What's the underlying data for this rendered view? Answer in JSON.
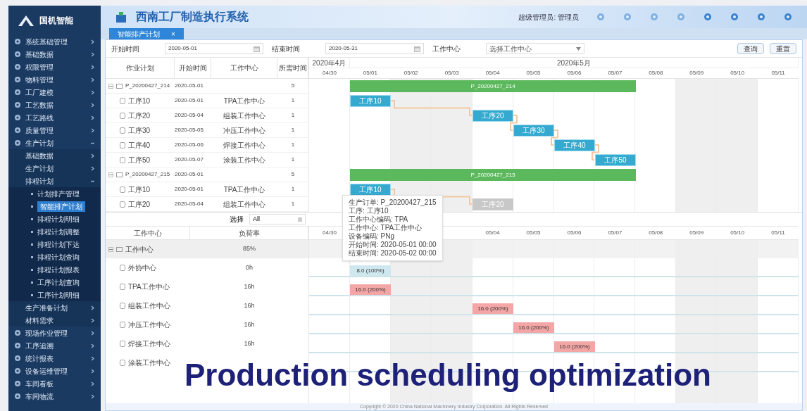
{
  "sidebar": {
    "logo": "国机智能",
    "items": [
      {
        "label": "系统基础管理",
        "expanded": false
      },
      {
        "label": "基础数据",
        "expanded": false
      },
      {
        "label": "权限管理",
        "expanded": false
      },
      {
        "label": "物料管理",
        "expanded": false
      },
      {
        "label": "工厂建模",
        "expanded": false
      },
      {
        "label": "工艺数据",
        "expanded": false
      },
      {
        "label": "工艺路线",
        "expanded": false
      },
      {
        "label": "质量管理",
        "expanded": false
      },
      {
        "label": "生产计划",
        "expanded": true,
        "children": [
          {
            "label": "基础数据",
            "expanded": false
          },
          {
            "label": "生产计划",
            "expanded": false
          },
          {
            "label": "排程计划",
            "expanded": true,
            "children": [
              {
                "label": "计划排产管理",
                "selected": false
              },
              {
                "label": "智能排产计划",
                "selected": true
              },
              {
                "label": "排程计划明细",
                "selected": false
              },
              {
                "label": "排程计划调整",
                "selected": false
              },
              {
                "label": "排程计划下达",
                "selected": false
              },
              {
                "label": "排程计划查询",
                "selected": false
              },
              {
                "label": "排程计划报表",
                "selected": false
              },
              {
                "label": "工序计划查询",
                "selected": false
              },
              {
                "label": "工序计划明细",
                "selected": false
              }
            ]
          },
          {
            "label": "生产准备计划",
            "expanded": false
          },
          {
            "label": "材料需求",
            "expanded": false
          }
        ]
      },
      {
        "label": "现场作业管理",
        "expanded": false
      },
      {
        "label": "工序追溯",
        "expanded": false
      },
      {
        "label": "统计报表",
        "expanded": false
      },
      {
        "label": "设备运维管理",
        "expanded": false
      },
      {
        "label": "车间看板",
        "expanded": false
      },
      {
        "label": "车间物流",
        "expanded": false
      }
    ]
  },
  "header": {
    "title": "西南工厂制造执行系统",
    "user": "超级管理员: 管理员"
  },
  "tabs": [
    {
      "label": "智能排产计划",
      "selected": true,
      "close": "×"
    }
  ],
  "filters": [
    {
      "label": "开始时间",
      "value": "2020-05-01",
      "kind": "date"
    },
    {
      "label": "结束时间",
      "value": "2020-05-31",
      "kind": "date"
    },
    {
      "label": "工作中心",
      "placeholder": "选择工作中心",
      "kind": "select"
    }
  ],
  "buttons": [
    "查询",
    "重置"
  ],
  "months": [
    "2020年4月",
    "2020年5月"
  ],
  "days": [
    {
      "label": "04/30",
      "weekend": false
    },
    {
      "label": "05/01",
      "weekend": false
    },
    {
      "label": "05/02",
      "weekend": true
    },
    {
      "label": "05/03",
      "weekend": true
    },
    {
      "label": "05/04",
      "weekend": false
    },
    {
      "label": "05/05",
      "weekend": false
    },
    {
      "label": "05/06",
      "weekend": false
    },
    {
      "label": "05/07",
      "weekend": false
    },
    {
      "label": "05/08",
      "weekend": false
    },
    {
      "label": "05/09",
      "weekend": true
    },
    {
      "label": "05/10",
      "weekend": true
    },
    {
      "label": "05/11",
      "weekend": false
    }
  ],
  "plan": {
    "columns": [
      "作业计划",
      "开始时间",
      "工作中心",
      "所需时间"
    ],
    "orders": [
      {
        "name": "P_20200427_214",
        "start": "2020-05-01",
        "hours": "5",
        "expanded": true,
        "bar_label": "P_20200427_214",
        "tasks": [
          {
            "name": "工序10",
            "start": "2020-05-01",
            "center": "TPA工作中心",
            "hours": "1",
            "bar_label": "工序10",
            "kind": "scheduled"
          },
          {
            "name": "工序20",
            "start": "2020-05-04",
            "center": "组装工作中心",
            "hours": "1",
            "bar_label": "工序20",
            "kind": "scheduled"
          },
          {
            "name": "工序30",
            "start": "2020-05-05",
            "center": "冲压工作中心",
            "hours": "1",
            "bar_label": "工序30",
            "kind": "scheduled"
          },
          {
            "name": "工序40",
            "start": "2020-05-06",
            "center": "焊接工作中心",
            "hours": "1",
            "bar_label": "工序40",
            "kind": "scheduled"
          },
          {
            "name": "工序50",
            "start": "2020-05-07",
            "center": "涂装工作中心",
            "hours": "1",
            "bar_label": "工序50",
            "kind": "scheduled"
          }
        ]
      },
      {
        "name": "P_20200427_215",
        "start": "2020-05-01",
        "hours": "5",
        "expanded": true,
        "bar_label": "P_20200427_215",
        "tasks": [
          {
            "name": "工序10",
            "start": "2020-05-01",
            "center": "TPA工作中心",
            "hours": "1",
            "bar_label": "工序10",
            "kind": "scheduled"
          },
          {
            "name": "工序20",
            "start": "2020-05-04",
            "center": "组装工作中心",
            "hours": "1",
            "bar_label": "工序20",
            "kind": "pending"
          }
        ]
      }
    ]
  },
  "tooltip": [
    "生产订单: P_20200427_215",
    "工序: 工序10",
    "工作中心编码: TPA",
    "工作中心: TPA工作中心",
    "设备编码: PNg",
    "开始时间: 2020-05-01 00:00",
    "结束时间: 2020-05-02 00:00"
  ],
  "load": {
    "filter_label": "选择",
    "filter_value": "All",
    "columns": [
      "工作中心",
      "负荷率"
    ],
    "days": [
      "04/30",
      "05/04",
      "05/05",
      "05/06",
      "05/07",
      "05/08",
      "05/09",
      "05/10",
      "05/11"
    ],
    "group": {
      "name": "工作中心",
      "rate": "85%",
      "expanded": true
    },
    "rows": [
      {
        "name": "外协中心",
        "rate": "0h",
        "bar": {
          "label": "8.0 (100%)",
          "color": "#cfe8ef"
        }
      },
      {
        "name": "TPA工作中心",
        "rate": "16h",
        "bar": {
          "label": "16.0 (200%)",
          "color": "#f4a6a6"
        }
      },
      {
        "name": "组装工作中心",
        "rate": "16h",
        "bar": {
          "label": "16.0 (200%)",
          "color": "#f4a6a6"
        }
      },
      {
        "name": "冲压工作中心",
        "rate": "16h",
        "bar": {
          "label": "16.0 (200%)",
          "color": "#f4a6a6"
        }
      },
      {
        "name": "焊接工作中心",
        "rate": "16h",
        "bar": {
          "label": "16.0 (200%)",
          "color": "#f4a6a6"
        }
      },
      {
        "name": "涂装工作中心"
      }
    ]
  },
  "footer": "Copyright © 2020 China National Machinery Industry Corporation. All Rights Reserved",
  "caption": "Production scheduling optimization"
}
